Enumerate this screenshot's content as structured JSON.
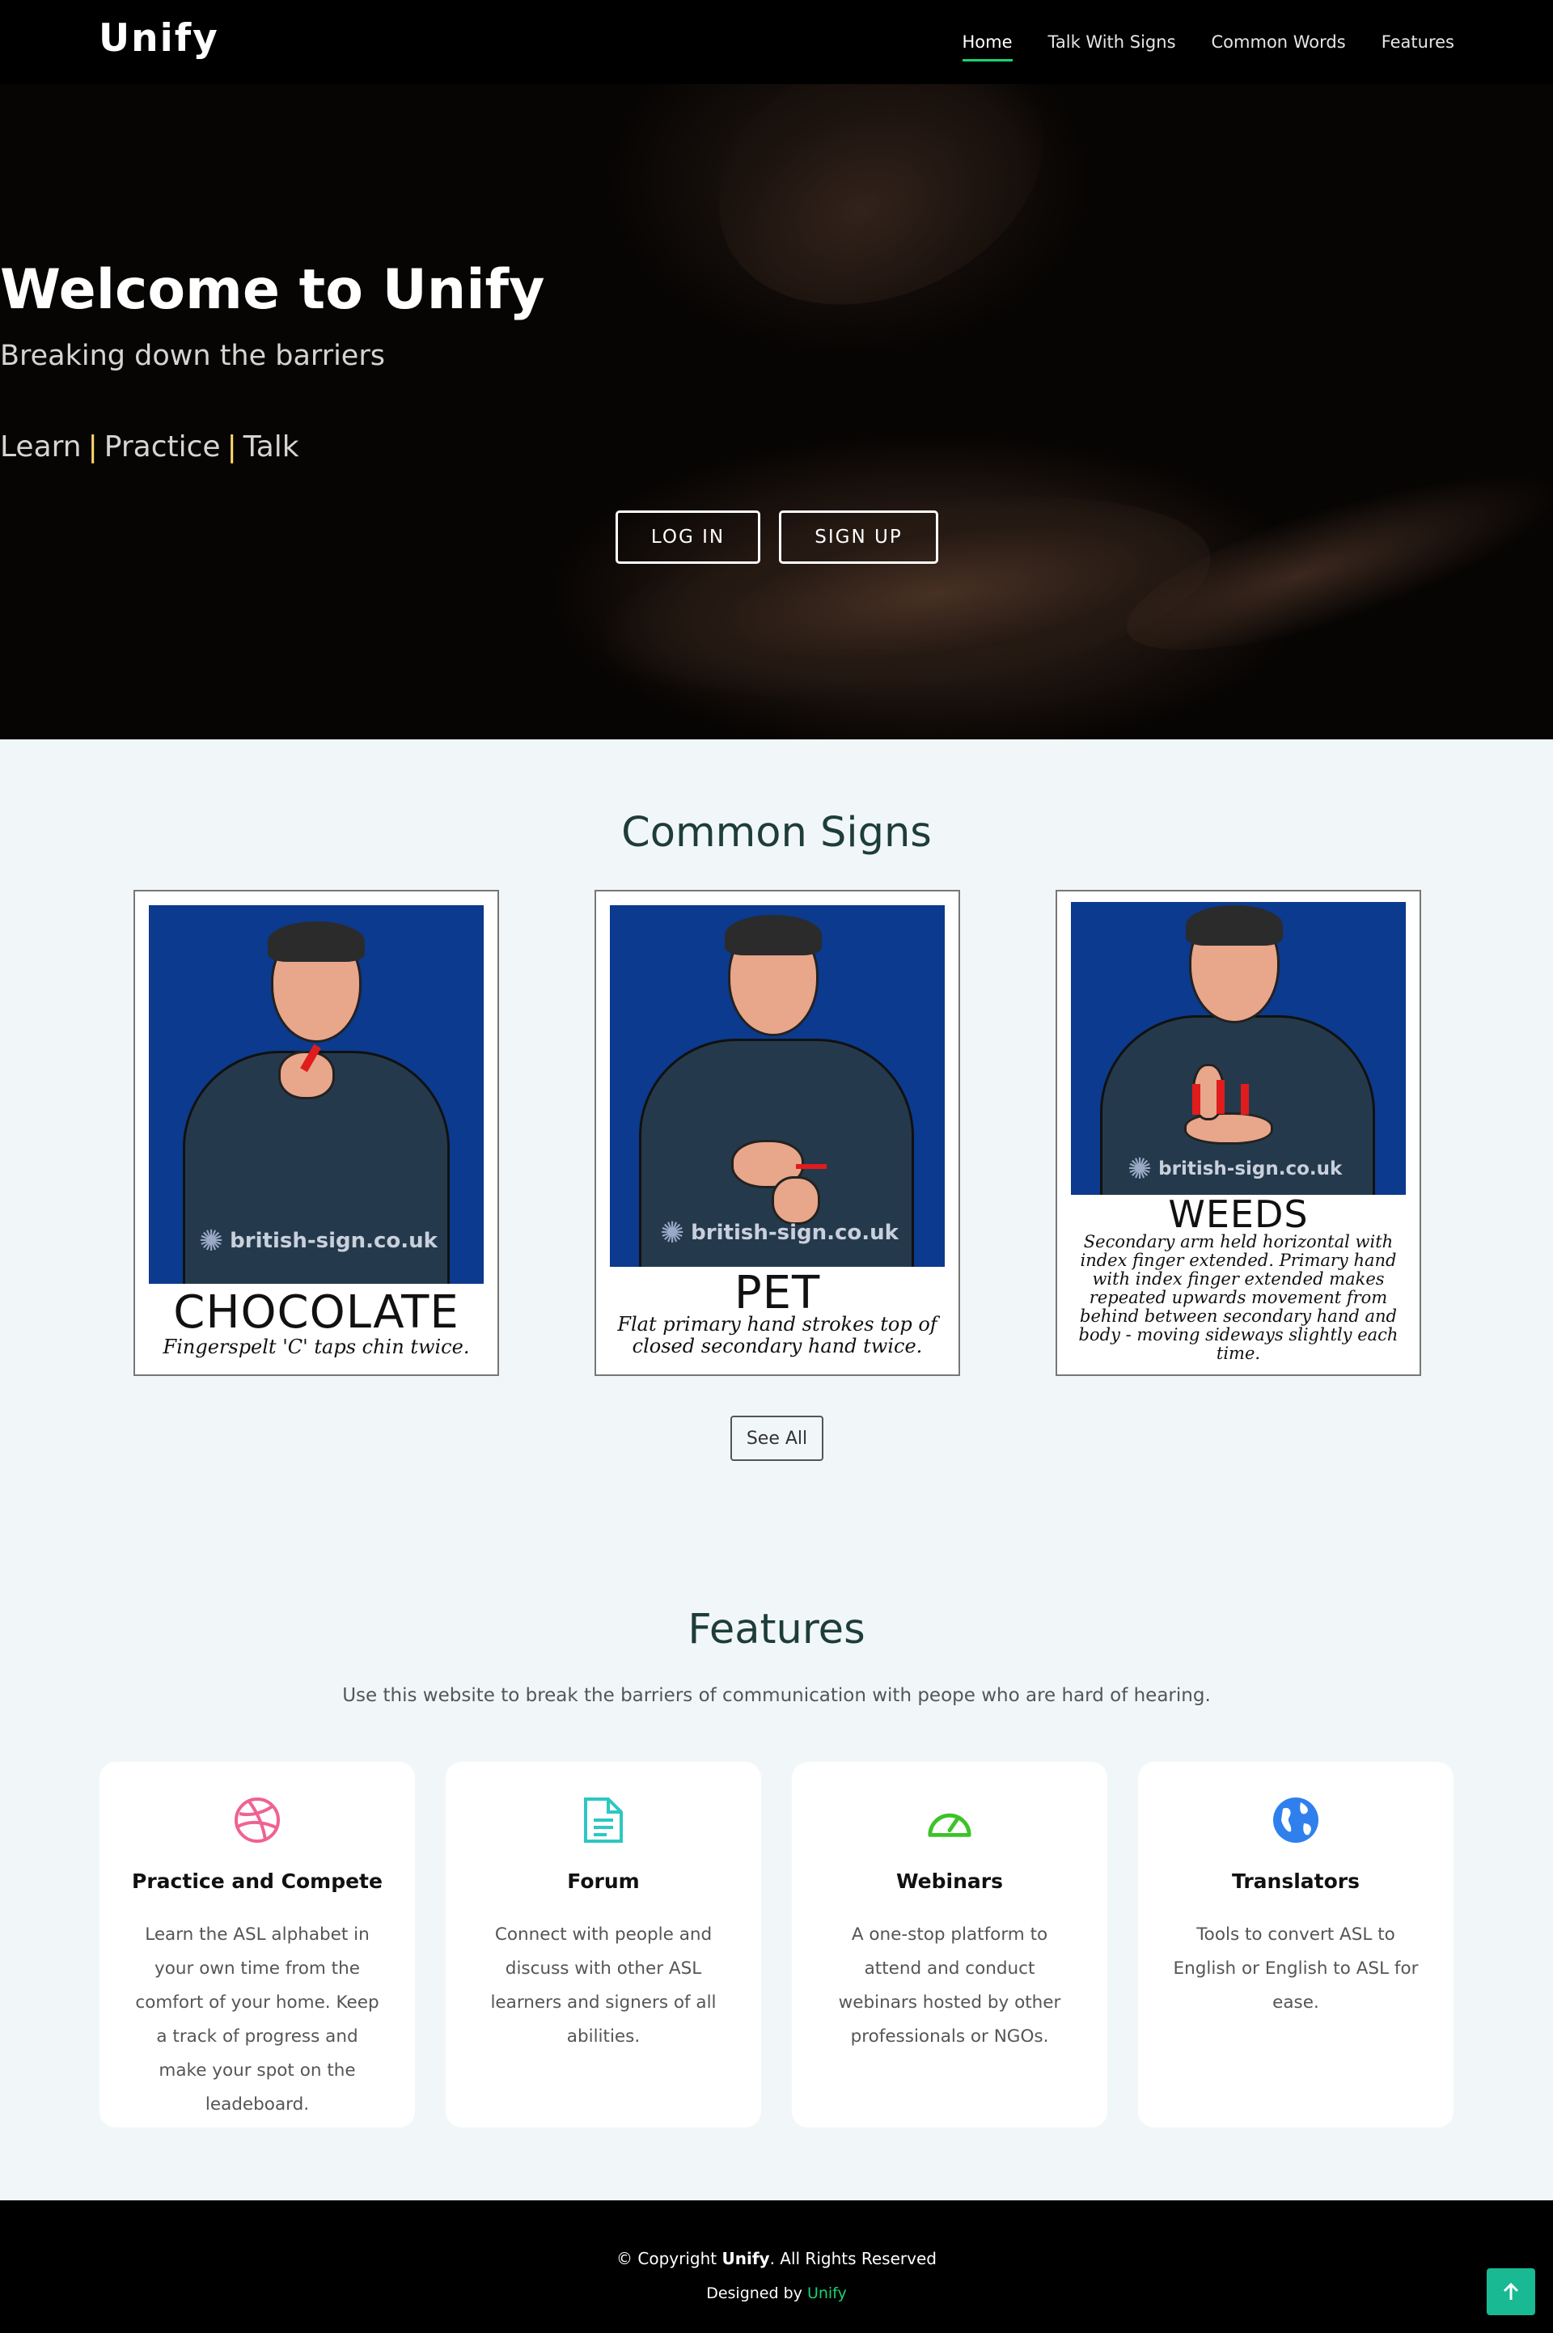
{
  "header": {
    "logo": "Unify",
    "nav": [
      {
        "label": "Home",
        "active": true
      },
      {
        "label": "Talk With Signs",
        "active": false
      },
      {
        "label": "Common Words",
        "active": false
      },
      {
        "label": "Features",
        "active": false
      }
    ]
  },
  "hero": {
    "title": "Welcome to Unify",
    "subtitle": "Breaking down the barriers",
    "tagline": {
      "learn": "Learn",
      "sep1": "|",
      "practice": "Practice",
      "sep2": "|",
      "talk": "Talk"
    },
    "login_label": "LOG IN",
    "signup_label": "SIGN UP"
  },
  "common_signs": {
    "title": "Common Signs",
    "cards": [
      {
        "word": "CHOCOLATE",
        "description": "Fingerspelt 'C' taps chin twice.",
        "watermark": "british-sign.co.uk"
      },
      {
        "word": "PET",
        "description": "Flat primary hand strokes top of closed secondary hand twice.",
        "watermark": "british-sign.co.uk"
      },
      {
        "word": "WEEDS",
        "description": "Secondary arm held horizontal with index finger extended. Primary hand with index finger extended makes repeated upwards movement from behind between secondary hand and body - moving sideways slightly each time.",
        "watermark": "british-sign.co.uk"
      }
    ],
    "see_all_label": "See All"
  },
  "features": {
    "title": "Features",
    "description": "Use this website to break the barriers of communication with peope who are hard of hearing.",
    "items": [
      {
        "icon": "dribbble-icon",
        "color": "#f06193",
        "title": "Practice and Compete",
        "description": "Learn the ASL alphabet in your own time from the comfort of your home. Keep a track of progress and make your spot on the leadeboard."
      },
      {
        "icon": "file-text-icon",
        "color": "#2ec7c2",
        "title": "Forum",
        "description": "Connect with people and discuss with other ASL learners and signers of all abilities."
      },
      {
        "icon": "speedometer-icon",
        "color": "#3cc328",
        "title": "Webinars",
        "description": "A one-stop platform to attend and conduct webinars hosted by other professionals or NGOs."
      },
      {
        "icon": "globe-icon",
        "color": "#2f80ed",
        "title": "Translators",
        "description": "Tools to convert ASL to English or English to ASL for ease."
      }
    ]
  },
  "footer": {
    "copyright_prefix": "© Copyright",
    "brand": "Unify",
    "copyright_suffix": ". All Rights Reserved",
    "designed_prefix": "Designed by",
    "designed_link": "Unify"
  },
  "colors": {
    "accent": "#18d26e",
    "back_to_top": "#18b993",
    "footer_bg": "#000000",
    "page_bg": "#f1f7f8"
  }
}
